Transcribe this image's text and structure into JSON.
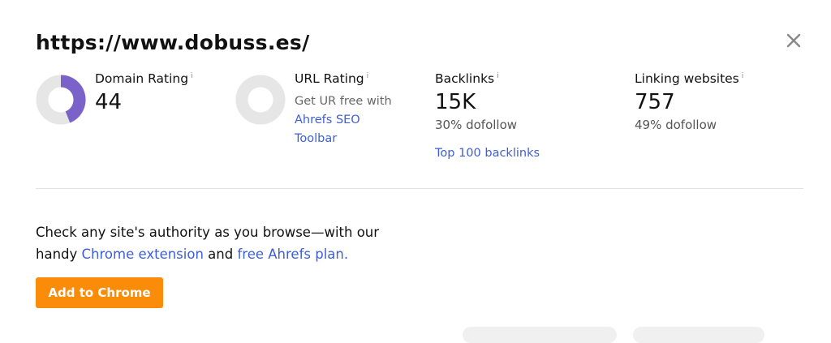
{
  "header": {
    "url": "https://www.dobuss.es/"
  },
  "metrics": {
    "domain_rating": {
      "label": "Domain Rating",
      "info": "i",
      "value": "44",
      "gauge_fraction": 0.44
    },
    "url_rating": {
      "label": "URL Rating",
      "info": "i",
      "note_text": "Get UR free with",
      "note_link": "Ahrefs SEO Toolbar"
    },
    "backlinks": {
      "label": "Backlinks",
      "info": "i",
      "value": "15K",
      "sub": "30% dofollow",
      "link": "Top 100 backlinks"
    },
    "linking_websites": {
      "label": "Linking websites",
      "info": "i",
      "value": "757",
      "sub": "49% dofollow"
    }
  },
  "promo": {
    "text_1": "Check any site's authority as you browse—with our handy",
    "link_1": "Chrome extension",
    "text_2": "and",
    "link_2": "free Ahrefs plan.",
    "button": "Add to Chrome"
  },
  "colors": {
    "accent": "#fa8c0a",
    "link": "#3d5fd6",
    "gauge": "#7b62c9",
    "gauge_track": "#e6e6e6"
  },
  "icons": {
    "close": "close-icon"
  }
}
